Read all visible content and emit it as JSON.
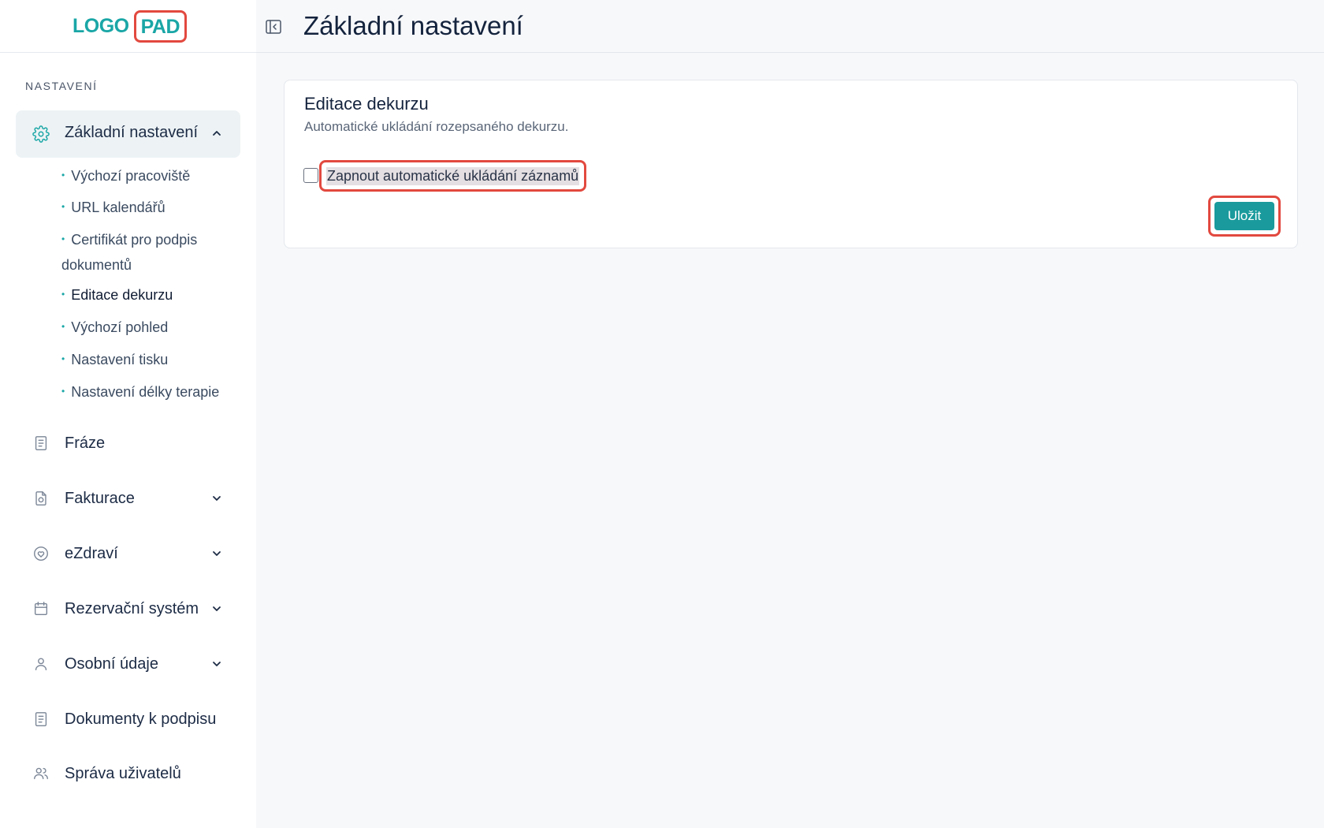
{
  "logo": {
    "part1": "LOGO",
    "part2": "PAD"
  },
  "header": {
    "title": "Základní nastavení"
  },
  "sidebar": {
    "section_label": "NASTAVENÍ",
    "active_item": "Základní nastavení",
    "sub_items": [
      "Výchozí pracoviště",
      "URL kalendářů",
      "Certifikát pro podpis dokumentů",
      "Editace dekurzu",
      "Výchozí pohled",
      "Nastavení tisku",
      "Nastavení délky terapie"
    ],
    "items": [
      {
        "label": "Fráze",
        "icon": "document-icon"
      },
      {
        "label": "Fakturace",
        "icon": "invoice-icon"
      },
      {
        "label": "eZdraví",
        "icon": "heart-icon"
      },
      {
        "label": "Rezervační systém",
        "icon": "calendar-icon"
      },
      {
        "label": "Osobní údaje",
        "icon": "user-icon"
      },
      {
        "label": "Dokumenty k podpisu",
        "icon": "document-icon"
      },
      {
        "label": "Správa uživatelů",
        "icon": "users-icon"
      }
    ]
  },
  "card": {
    "title": "Editace dekurzu",
    "description": "Automatické ukládání rozepsaného dekurzu.",
    "checkbox_label": "Zapnout automatické ukládání záznamů",
    "checkbox_checked": false,
    "save_label": "Uložit"
  },
  "colors": {
    "accent": "#1a9a9c",
    "highlight": "#e2493f"
  }
}
